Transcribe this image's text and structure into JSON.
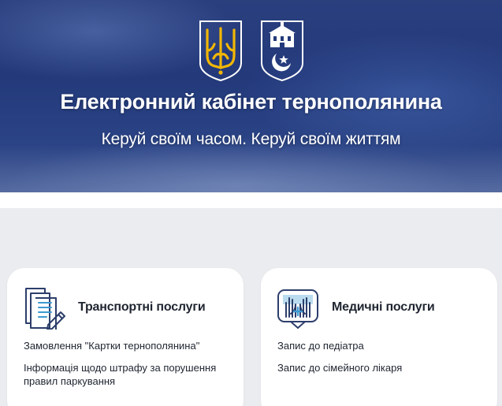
{
  "header": {
    "title": "Електронний кабінет тернополянина",
    "subtitle": "Керуй своїм часом. Керуй своїм життям",
    "emblems": [
      "ukraine-trident-icon",
      "ternopil-city-coat-of-arms-icon"
    ]
  },
  "colors": {
    "hero_blue": "#23397a",
    "trident_gold": "#f2b705",
    "icon_navy": "#2c3e6b",
    "icon_teal": "#3c9ad1",
    "content_bg": "#ebecf0",
    "text": "#1f2530"
  },
  "services": [
    {
      "title": "Транспортні послуги",
      "icon": "documents-pen-icon",
      "links": [
        "Замовлення \"Картки тернополянина\"",
        "Інформація щодо штрафу за порушення правил паркування"
      ]
    },
    {
      "title": "Медичні послуги",
      "icon": "medical-hands-icon",
      "links": [
        "Запис до педіатра",
        "Запис до сімейного лікаря"
      ]
    }
  ]
}
